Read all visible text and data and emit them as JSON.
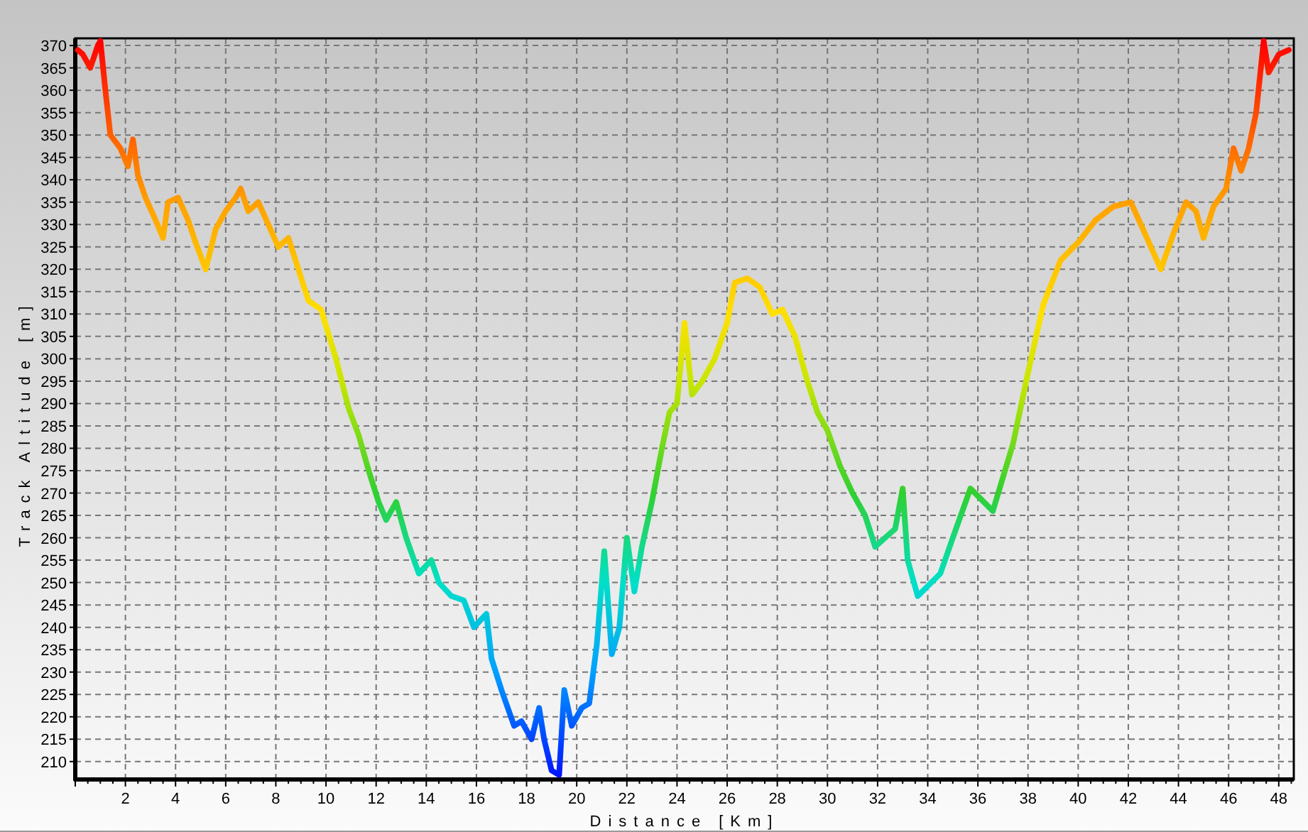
{
  "chart_data": {
    "type": "line",
    "xlabel": "Distance [Km]",
    "ylabel": "Track Altitude [m]",
    "xlim": [
      0,
      48.6
    ],
    "ylim": [
      206,
      371.6
    ],
    "xticks": [
      2,
      4,
      6,
      8,
      10,
      12,
      14,
      16,
      18,
      20,
      22,
      24,
      26,
      28,
      30,
      32,
      34,
      36,
      38,
      40,
      42,
      44,
      46,
      48
    ],
    "yticks": [
      210,
      215,
      220,
      225,
      230,
      235,
      240,
      245,
      250,
      255,
      260,
      265,
      270,
      275,
      280,
      285,
      290,
      295,
      300,
      305,
      310,
      315,
      320,
      325,
      330,
      335,
      340,
      345,
      350,
      355,
      360,
      365,
      370
    ],
    "x": [
      0.1,
      0.3,
      0.6,
      0.9,
      1.0,
      1.2,
      1.4,
      1.8,
      2.1,
      2.3,
      2.5,
      2.8,
      3.2,
      3.5,
      3.7,
      4.1,
      4.5,
      4.8,
      5.2,
      5.6,
      6.0,
      6.4,
      6.6,
      6.9,
      7.3,
      7.7,
      8.1,
      8.5,
      8.9,
      9.3,
      9.8,
      10.4,
      10.9,
      11.3,
      11.7,
      12.1,
      12.4,
      12.8,
      13.2,
      13.7,
      14.2,
      14.5,
      15.0,
      15.5,
      15.9,
      16.4,
      16.6,
      17.0,
      17.5,
      17.8,
      18.2,
      18.5,
      18.7,
      19.0,
      19.3,
      19.5,
      19.8,
      20.2,
      20.5,
      20.8,
      21.1,
      21.4,
      21.7,
      22.0,
      22.3,
      22.6,
      23.0,
      23.4,
      23.7,
      24.0,
      24.3,
      24.6,
      25.0,
      25.5,
      26.0,
      26.3,
      26.8,
      27.3,
      27.8,
      28.2,
      28.7,
      29.2,
      29.6,
      30.0,
      30.5,
      31.0,
      31.5,
      31.9,
      32.3,
      32.7,
      33.0,
      33.2,
      33.6,
      34.5,
      35.0,
      35.7,
      36.6,
      37.4,
      38.0,
      38.6,
      39.3,
      40.0,
      40.7,
      41.4,
      42.1,
      42.5,
      43.3,
      43.8,
      44.3,
      44.7,
      45.0,
      45.4,
      45.9,
      46.2,
      46.5,
      46.8,
      47.1,
      47.4,
      47.6,
      48.0,
      48.4
    ],
    "grid": true,
    "series": [
      {
        "values": [
          369,
          368,
          365,
          370,
          371,
          360,
          350,
          347,
          343,
          349,
          341,
          336,
          331,
          327,
          335,
          336,
          331,
          326,
          320,
          329,
          333,
          336,
          338,
          333,
          335,
          330,
          325,
          327,
          320,
          313,
          311,
          300,
          289,
          283,
          275,
          268,
          264,
          268,
          260,
          252,
          255,
          250,
          247,
          246,
          240,
          243,
          233,
          226,
          218,
          219,
          215,
          222,
          215,
          208,
          207,
          226,
          218,
          222,
          223,
          236,
          257,
          234,
          240,
          260,
          248,
          258,
          268,
          280,
          288,
          290,
          308,
          292,
          295,
          300,
          308,
          317,
          318,
          316,
          310,
          311,
          305,
          295,
          288,
          284,
          276,
          270,
          265,
          258,
          260,
          262,
          271,
          255,
          247,
          252,
          260,
          271,
          266,
          281,
          297,
          312,
          322,
          326,
          331,
          334,
          335,
          330,
          320,
          328,
          335,
          333,
          327,
          334,
          338,
          347,
          342,
          347,
          355,
          371,
          364,
          368,
          369
        ]
      }
    ]
  }
}
